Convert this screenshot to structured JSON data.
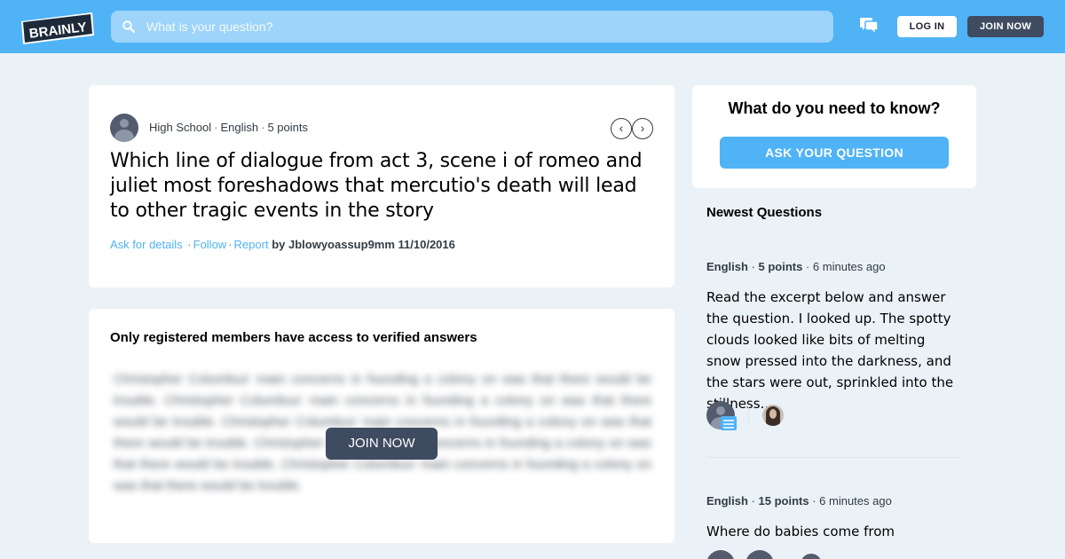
{
  "header": {
    "logo_text": "BRAINLY",
    "search_placeholder": "What is your question?",
    "icons": {
      "search": "search-icon",
      "messages": "chat-icon"
    },
    "login_label": "LOG IN",
    "join_label": "JOIN NOW",
    "colors": {
      "bar": "#4fb3f6",
      "search_bg": "#9ed4fa",
      "join_bg": "#3f4b60"
    }
  },
  "question": {
    "meta": {
      "level": "High School",
      "subject": "English",
      "points": "5 points"
    },
    "title": "Which line of dialogue from act 3, scene i of romeo and juliet most foreshadows that mercutio's death will lead to other tragic events in the story",
    "actions": {
      "ask_details": "Ask for details",
      "follow": "Follow",
      "report": "Report",
      "by": "by Jblowyoassup9mm 11/10/2016"
    },
    "prev_label": "‹",
    "next_label": "›"
  },
  "answer": {
    "locked_title": "Only registered members have access to verified answers",
    "blurred_text": "Christopher Columbus' main concerns in founding a colony on was that there would be trouble. Christopher Columbus' main concerns in founding a colony on was that there would be trouble. Christopher Columbus' main concerns in founding a colony on was that there would be trouble. Christopher Columbus' main concerns in founding a colony on was that there would be trouble. Christopher Columbus' main concerns in founding a colony on was that there would be trouble.",
    "join_label": "JOIN NOW"
  },
  "sidebar": {
    "ask_title": "What do you need to know?",
    "ask_button": "ASK YOUR QUESTION",
    "newest_title": "Newest Questions",
    "questions": [
      {
        "subject": "English",
        "points": "5 points",
        "time": "6 minutes ago",
        "text": "Read the excerpt below and answer the question. I looked up. The spotty clouds looked like bits of melting snow pressed into the darkness, and the stars were out, sprinkled into the stillness..."
      },
      {
        "subject": "English",
        "points": "15 points",
        "time": "6 minutes ago",
        "text": "Where do babies come from"
      }
    ]
  }
}
